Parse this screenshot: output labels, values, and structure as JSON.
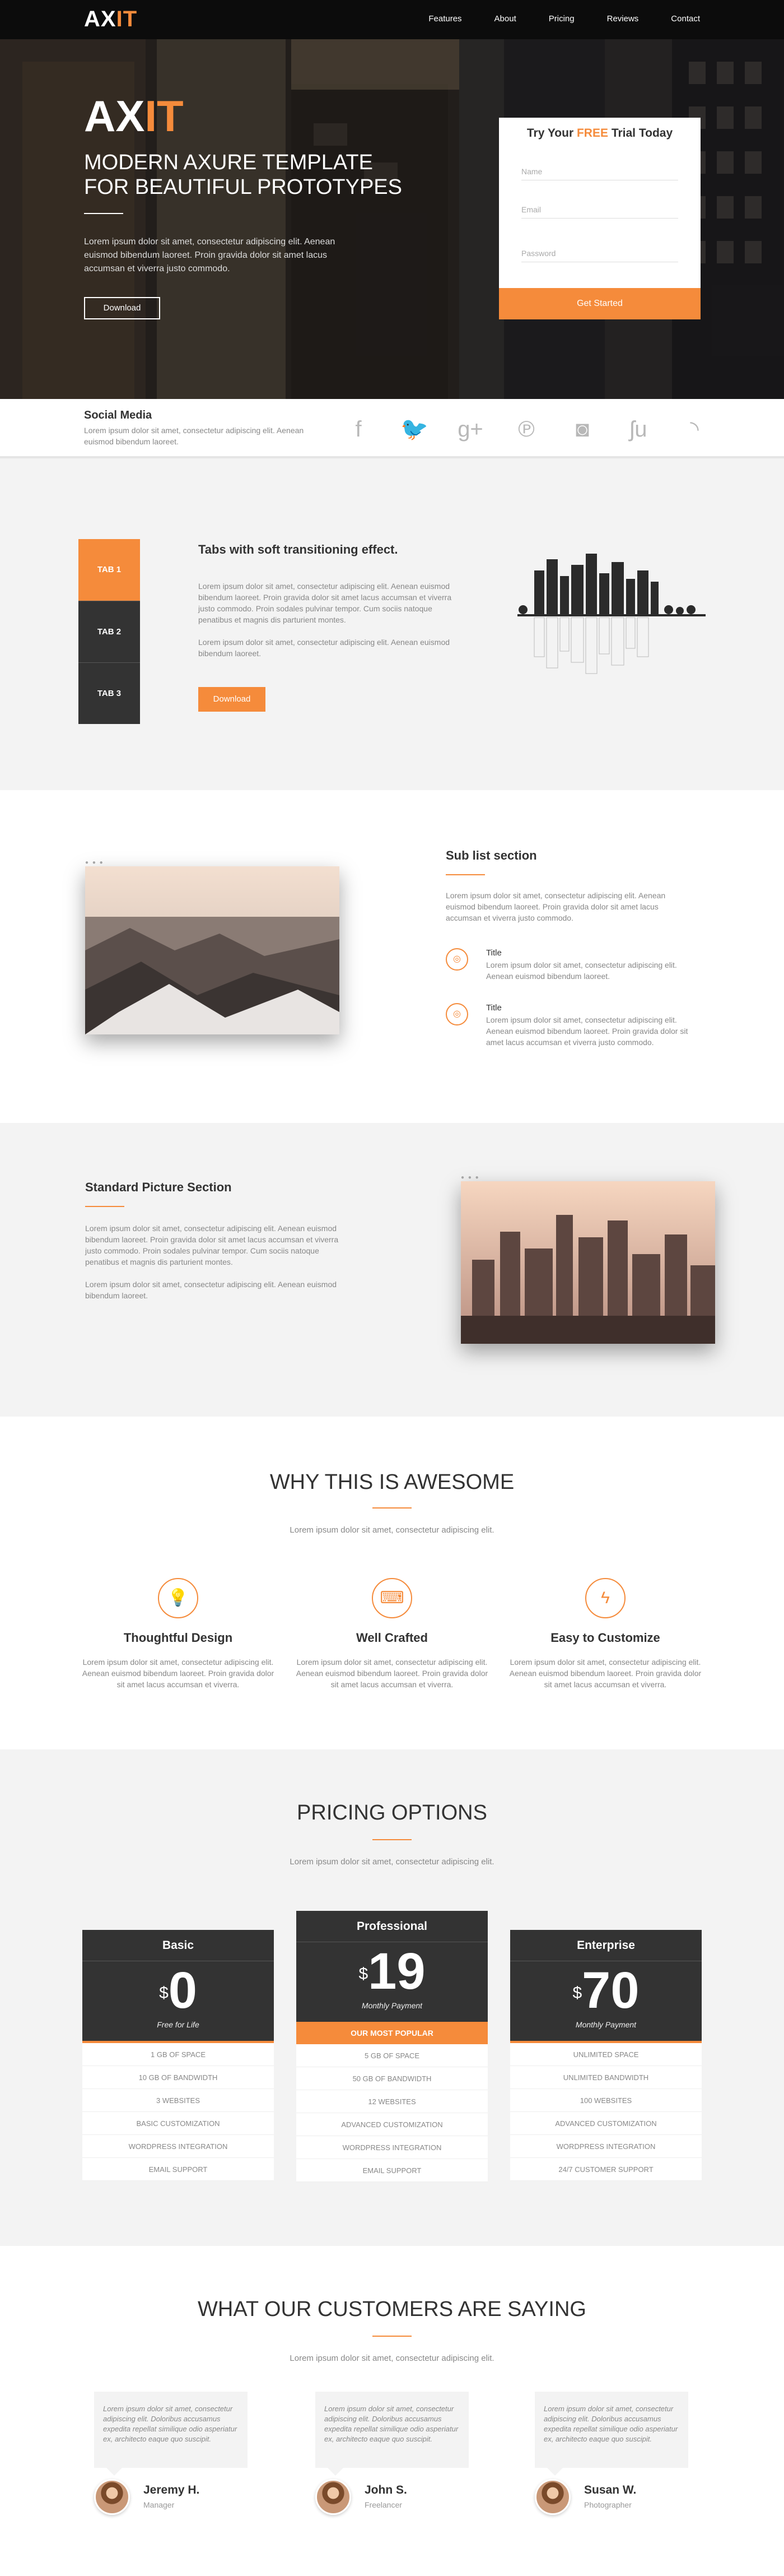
{
  "nav": {
    "logo_a": "AX",
    "logo_b": "IT",
    "links": [
      "Features",
      "About",
      "Pricing",
      "Reviews",
      "Contact"
    ]
  },
  "hero": {
    "logo_a": "AX",
    "logo_b": "IT",
    "title": "Modern Axure Template For Beautiful Prototypes",
    "text": "Lorem ipsum dolor sit amet, consectetur adipiscing elit. Aenean euismod bibendum laoreet. Proin gravida dolor sit amet lacus accumsan et viverra justo commodo.",
    "button": "Download"
  },
  "trial": {
    "title_a": "Try Your",
    "title_b": "FREE",
    "title_c": "Trial Today",
    "name_placeholder": "Name",
    "email_placeholder": "Email",
    "password_placeholder": "Password",
    "submit": "Get Started"
  },
  "social": {
    "title": "Social Media",
    "text": "Lorem ipsum dolor sit amet, consectetur adipiscing elit. Aenean euismod bibendum laoreet.",
    "icons": [
      {
        "name": "facebook-icon",
        "glyph": "f"
      },
      {
        "name": "twitter-icon",
        "glyph": "🐦"
      },
      {
        "name": "google-plus-icon",
        "glyph": "g+"
      },
      {
        "name": "pinterest-icon",
        "glyph": "℗"
      },
      {
        "name": "instagram-icon",
        "glyph": "◙"
      },
      {
        "name": "stumbleupon-icon",
        "glyph": "ʃu"
      },
      {
        "name": "rss-icon",
        "glyph": "◝"
      }
    ]
  },
  "tabs": {
    "items": [
      "TAB 1",
      "TAB 2",
      "TAB 3"
    ],
    "title": "Tabs with soft transitioning effect.",
    "p1": "Lorem ipsum dolor sit amet, consectetur adipiscing elit. Aenean euismod bibendum laoreet. Proin gravida dolor sit amet lacus accumsan et viverra justo commodo. Proin sodales pulvinar tempor. Cum sociis natoque penatibus et magnis dis parturient montes.",
    "p2": "Lorem ipsum dolor sit amet, consectetur adipiscing elit. Aenean euismod bibendum laoreet.",
    "button": "Download"
  },
  "sublist": {
    "title": "Sub list section",
    "intro": "Lorem ipsum dolor sit amet, consectetur adipiscing elit. Aenean euismod bibendum laoreet. Proin gravida dolor sit amet lacus accumsan et viverra justo commodo.",
    "items": [
      {
        "title": "Title",
        "text": "Lorem ipsum dolor sit amet, consectetur adipiscing elit. Aenean euismod bibendum laoreet."
      },
      {
        "title": "Title",
        "text": "Lorem ipsum dolor sit amet, consectetur adipiscing elit. Aenean euismod bibendum laoreet. Proin gravida dolor sit amet lacus accumsan et viverra justo commodo."
      }
    ]
  },
  "standard": {
    "title": "Standard Picture Section",
    "p1": "Lorem ipsum dolor sit amet, consectetur adipiscing elit. Aenean euismod bibendum laoreet. Proin gravida dolor sit amet lacus accumsan et viverra justo commodo. Proin sodales pulvinar tempor. Cum sociis natoque penatibus et magnis dis parturient montes.",
    "p2": "Lorem ipsum dolor sit amet, consectetur adipiscing elit. Aenean euismod bibendum laoreet."
  },
  "why": {
    "title": "Why This Is Awesome",
    "sub": "Lorem ipsum dolor sit amet, consectetur adipiscing elit.",
    "features": [
      {
        "icon": "lightbulb-icon",
        "glyph": "💡",
        "title": "Thoughtful Design",
        "text": "Lorem ipsum dolor sit amet, consectetur adipiscing elit. Aenean euismod bibendum laoreet. Proin gravida dolor sit amet lacus accumsan et viverra."
      },
      {
        "icon": "keyboard-icon",
        "glyph": "⌨",
        "title": "Well Crafted",
        "text": "Lorem ipsum dolor sit amet, consectetur adipiscing elit. Aenean euismod bibendum laoreet. Proin gravida dolor sit amet lacus accumsan et viverra."
      },
      {
        "icon": "lightning-icon",
        "glyph": "ϟ",
        "title": "Easy to Customize",
        "text": "Lorem ipsum dolor sit amet, consectetur adipiscing elit. Aenean euismod bibendum laoreet. Proin gravida dolor sit amet lacus accumsan et viverra."
      }
    ]
  },
  "pricing": {
    "title": "Pricing Options",
    "sub": "Lorem ipsum dolor sit amet, consectetur adipiscing elit.",
    "plans": [
      {
        "name": "Basic",
        "currency": "$",
        "amount": "0",
        "note": "Free for Life",
        "features": [
          "1 GB of space",
          "10 GB of bandwidth",
          "3 websites",
          "Basic customization",
          "WordPress integration",
          "Email support"
        ]
      },
      {
        "name": "Professional",
        "currency": "$",
        "amount": "19",
        "note": "Monthly Payment",
        "badge": "OUR MOST POPULAR",
        "features": [
          "5 GB of space",
          "50 GB of bandwidth",
          "12 websites",
          "Advanced customization",
          "WordPress integration",
          "Email support"
        ]
      },
      {
        "name": "Enterprise",
        "currency": "$",
        "amount": "70",
        "note": "Monthly Payment",
        "features": [
          "Unlimited space",
          "Unlimited bandwidth",
          "100 websites",
          "Advanced customization",
          "WordPress integration",
          "24/7 customer support"
        ]
      }
    ]
  },
  "testimonials": {
    "title": "What Our Customers Are Saying",
    "sub": "Lorem ipsum dolor sit amet, consectetur adipiscing elit.",
    "items": [
      {
        "quote": "Lorem ipsum dolor sit amet, consectetur adipiscing elit. Doloribus accusamus expedita repellat similique odio asperiatur ex, architecto eaque quo suscipit.",
        "name": "Jeremy H.",
        "role": "Manager"
      },
      {
        "quote": "Lorem ipsum dolor sit amet, consectetur adipiscing elit. Doloribus accusamus expedita repellat similique odio asperiatur ex, architecto eaque quo suscipit.",
        "name": "John S.",
        "role": "Freelancer"
      },
      {
        "quote": "Lorem ipsum dolor sit amet, consectetur adipiscing elit. Doloribus accusamus expedita repellat similique odio asperiatur ex, architecto eaque quo suscipit.",
        "name": "Susan W.",
        "role": "Photographer"
      }
    ]
  },
  "colors": {
    "accent": "#f58b3b",
    "dark": "#333333",
    "light_bg": "#f3f3f3"
  }
}
